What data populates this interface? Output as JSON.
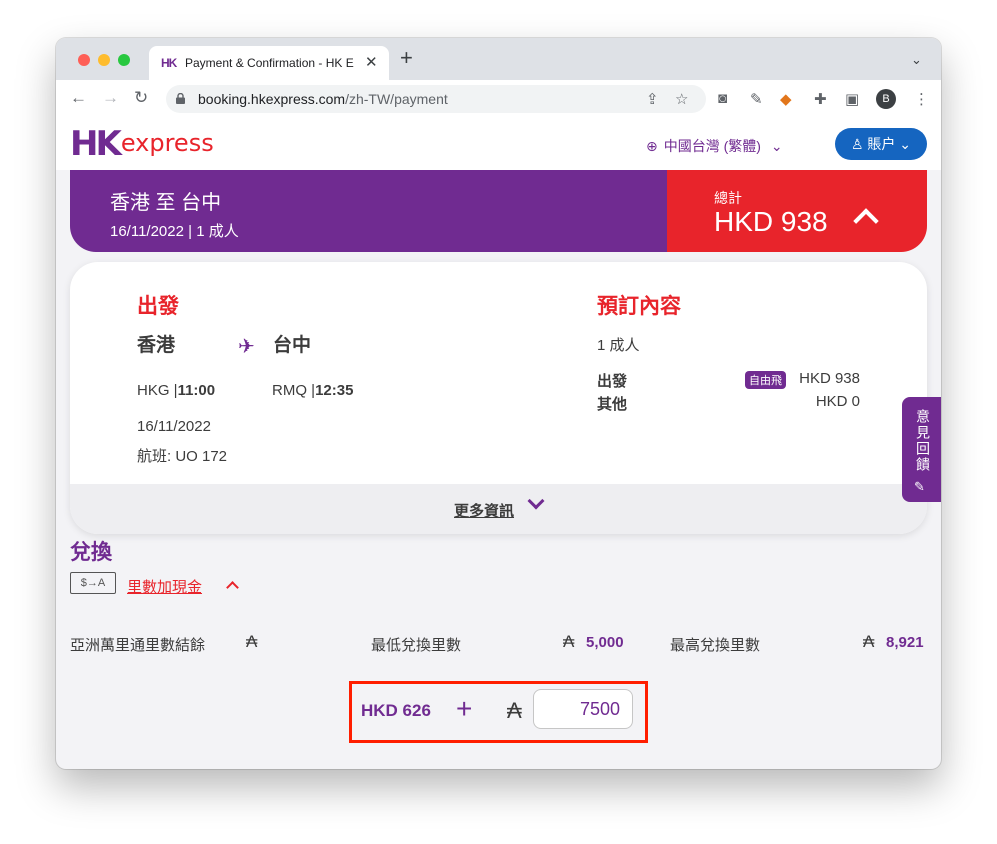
{
  "browser": {
    "tab_title": "Payment & Confirmation - HK E",
    "tab_favicon": "HK",
    "url_host": "booking.hkexpress.com",
    "url_path": "/zh-TW/payment",
    "profile_initial": "B"
  },
  "header": {
    "logo_hk": "HK",
    "logo_express": "express",
    "language": "中國台灣 (繁體)",
    "account": "賬户"
  },
  "summary": {
    "route": "香港 至 台中",
    "sub": "16/11/2022 | 1 成人",
    "total_label": "總計",
    "total_value": "HKD 938"
  },
  "departure": {
    "title": "出發",
    "from_city": "香港",
    "to_city": "台中",
    "from_code": "HKG |",
    "from_time": "11:00",
    "to_code": "RMQ |",
    "to_time": "12:35",
    "date": "16/11/2022",
    "flight": "航班: UO 172"
  },
  "booking": {
    "title": "預訂內容",
    "passengers": "1 成人",
    "dep_label": "出發",
    "badge": "自由飛",
    "dep_value": "HKD 938",
    "other_label": "其他",
    "other_value": "HKD 0"
  },
  "more_info": "更多資訊",
  "feedback": "意見回饋",
  "redeem": {
    "title": "兌換",
    "cash_icon_label": "$→A",
    "mile_plus": "里數加現金",
    "balance_label": "亞洲萬里通里數結餘",
    "min_label": "最低兌換里數",
    "min_value": "5,000",
    "max_label": "最高兌換里數",
    "max_value": "8,921",
    "cash_amount": "HKD 626",
    "plus": "+",
    "miles_input": "7500"
  },
  "icons": {
    "asia_miles_symbol": "₳"
  },
  "colors": {
    "brand_purple": "#702b91",
    "brand_red": "#e8242b",
    "account_blue": "#1565c0",
    "highlight_red": "#ff1e00"
  }
}
